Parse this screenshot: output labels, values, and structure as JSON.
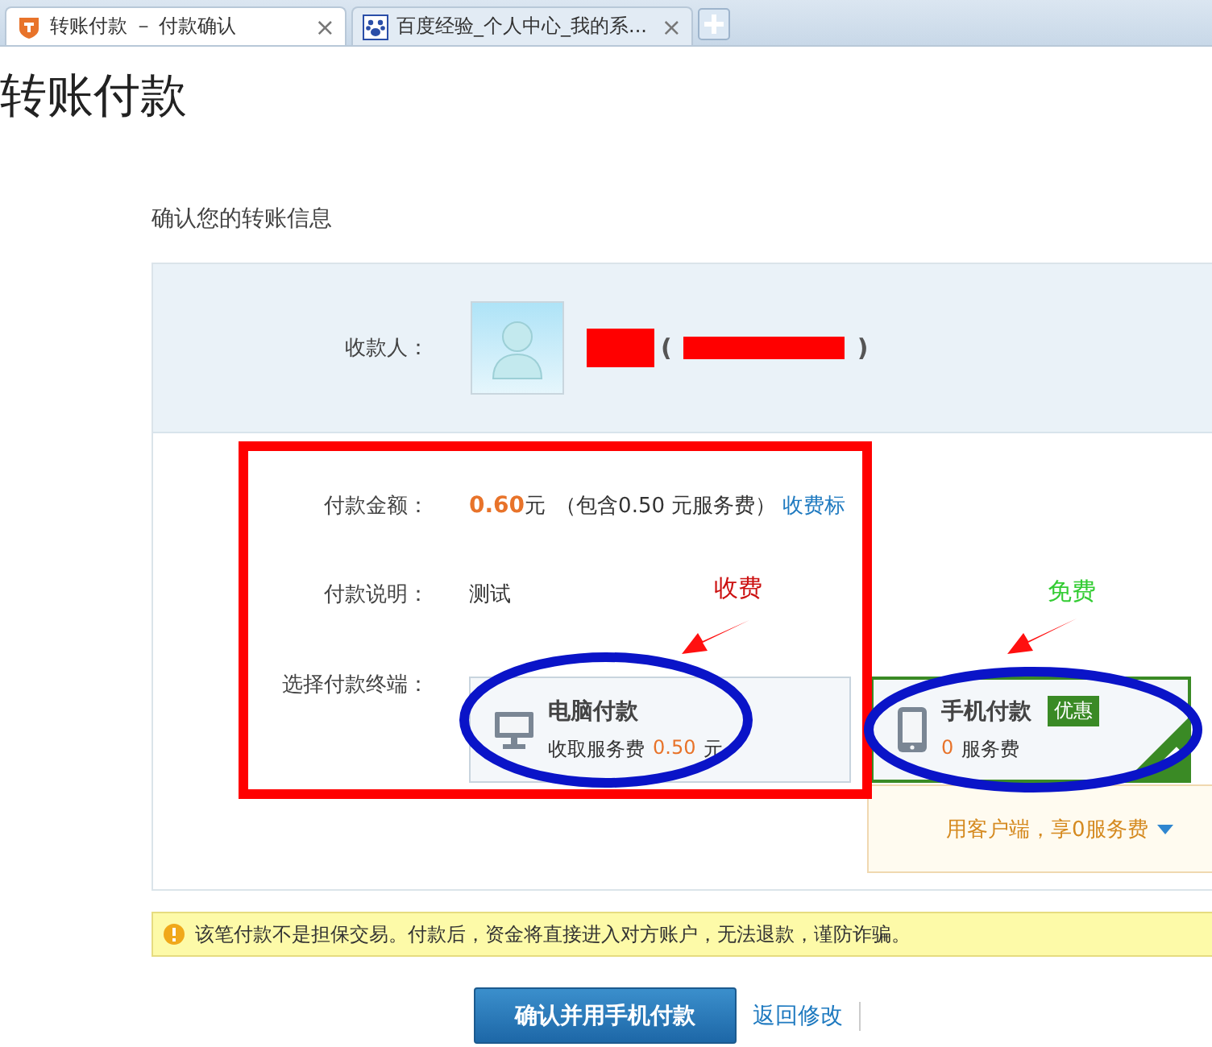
{
  "tabs": [
    {
      "title": "转账付款 － 付款确认",
      "selected": true,
      "close": "×"
    },
    {
      "title": "百度经验_个人中心_我的系...",
      "selected": false,
      "close": "×"
    }
  ],
  "page_title": "转账付款",
  "section_title": "确认您的转账信息",
  "payee": {
    "label": "收款人：",
    "open_paren": "(",
    "close_paren": ")"
  },
  "amount": {
    "label": "付款金额：",
    "value": "0.60",
    "unit": "元",
    "note": "（包含0.50 元服务费）",
    "link": "收费标"
  },
  "description": {
    "label": "付款说明：",
    "value": "测试"
  },
  "terminal": {
    "label": "选择付款终端：",
    "options": [
      {
        "kind": "computer",
        "title": "电脑付款",
        "fee_prefix": "收取服务费",
        "fee": "0.50",
        "fee_suffix": "元",
        "selected": false
      },
      {
        "kind": "phone",
        "title": "手机付款",
        "badge": "优惠",
        "fee": "0",
        "fee_suffix": "服务费",
        "selected": true
      }
    ],
    "tip": "用客户端，享0服务费"
  },
  "warning": "该笔付款不是担保交易。付款后，资金将直接进入对方账户，无法退款，谨防诈骗。",
  "buttons": {
    "confirm": "确认并用手机付款",
    "back": "返回修改"
  },
  "annotations": [
    {
      "text": "收费",
      "color": "#cc1111"
    },
    {
      "text": "免费",
      "color": "#33cc33"
    }
  ]
}
